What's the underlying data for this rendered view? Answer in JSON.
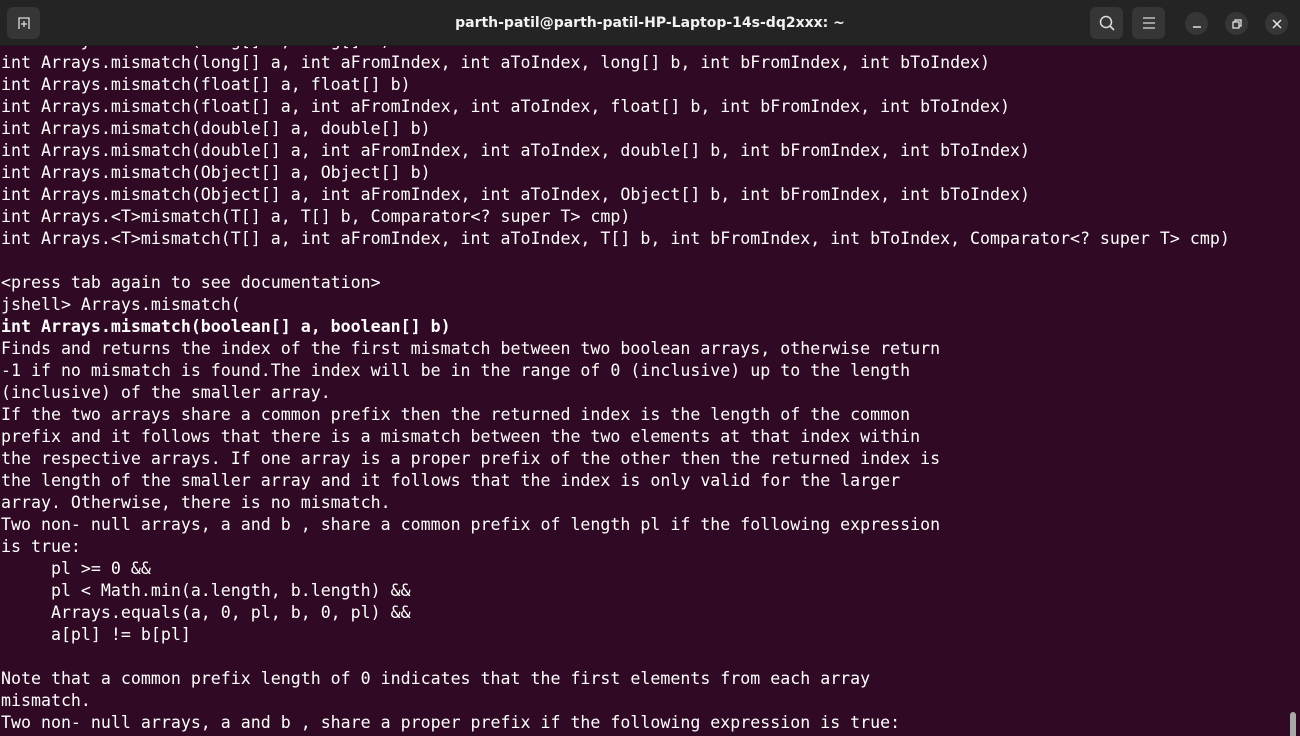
{
  "window": {
    "title": "parth-patil@parth-patil-HP-Laptop-14s-dq2xxx: ~",
    "icons": [
      "new-tab-icon",
      "search-icon",
      "menu-icon",
      "minimize-icon",
      "restore-icon",
      "close-icon"
    ]
  },
  "colors": {
    "background": "#300a24",
    "titlebar": "#242424",
    "text": "#ffffff"
  },
  "terminal": {
    "lines": [
      {
        "text": "int Arrays.mismatch(long[] a, long[] b)",
        "bold": false
      },
      {
        "text": "int Arrays.mismatch(long[] a, int aFromIndex, int aToIndex, long[] b, int bFromIndex, int bToIndex)",
        "bold": false
      },
      {
        "text": "int Arrays.mismatch(float[] a, float[] b)",
        "bold": false
      },
      {
        "text": "int Arrays.mismatch(float[] a, int aFromIndex, int aToIndex, float[] b, int bFromIndex, int bToIndex)",
        "bold": false
      },
      {
        "text": "int Arrays.mismatch(double[] a, double[] b)",
        "bold": false
      },
      {
        "text": "int Arrays.mismatch(double[] a, int aFromIndex, int aToIndex, double[] b, int bFromIndex, int bToIndex)",
        "bold": false
      },
      {
        "text": "int Arrays.mismatch(Object[] a, Object[] b)",
        "bold": false
      },
      {
        "text": "int Arrays.mismatch(Object[] a, int aFromIndex, int aToIndex, Object[] b, int bFromIndex, int bToIndex)",
        "bold": false
      },
      {
        "text": "int Arrays.<T>mismatch(T[] a, T[] b, Comparator<? super T> cmp)",
        "bold": false
      },
      {
        "text": "int Arrays.<T>mismatch(T[] a, int aFromIndex, int aToIndex, T[] b, int bFromIndex, int bToIndex, Comparator<? super T> cmp)",
        "bold": false
      },
      {
        "text": "",
        "bold": false
      },
      {
        "text": "<press tab again to see documentation>",
        "bold": false
      },
      {
        "text": "jshell> Arrays.mismatch(",
        "bold": false
      },
      {
        "text": "int Arrays.mismatch(boolean[] a, boolean[] b)",
        "bold": true
      },
      {
        "text": "Finds and returns the index of the first mismatch between two boolean arrays, otherwise return",
        "bold": false
      },
      {
        "text": "-1 if no mismatch is found.The index will be in the range of 0 (inclusive) up to the length",
        "bold": false
      },
      {
        "text": "(inclusive) of the smaller array.",
        "bold": false
      },
      {
        "text": "If the two arrays share a common prefix then the returned index is the length of the common",
        "bold": false
      },
      {
        "text": "prefix and it follows that there is a mismatch between the two elements at that index within",
        "bold": false
      },
      {
        "text": "the respective arrays. If one array is a proper prefix of the other then the returned index is",
        "bold": false
      },
      {
        "text": "the length of the smaller array and it follows that the index is only valid for the larger",
        "bold": false
      },
      {
        "text": "array. Otherwise, there is no mismatch.",
        "bold": false
      },
      {
        "text": "Two non- null arrays, a and b , share a common prefix of length pl if the following expression",
        "bold": false
      },
      {
        "text": "is true:",
        "bold": false
      },
      {
        "text": "     pl >= 0 &&",
        "bold": false
      },
      {
        "text": "     pl < Math.min(a.length, b.length) &&",
        "bold": false
      },
      {
        "text": "     Arrays.equals(a, 0, pl, b, 0, pl) &&",
        "bold": false
      },
      {
        "text": "     a[pl] != b[pl]",
        "bold": false
      },
      {
        "text": "",
        "bold": false
      },
      {
        "text": "Note that a common prefix length of 0 indicates that the first elements from each array",
        "bold": false
      },
      {
        "text": "mismatch.",
        "bold": false
      },
      {
        "text": "Two non- null arrays, a and b , share a proper prefix if the following expression is true:",
        "bold": false
      }
    ]
  }
}
